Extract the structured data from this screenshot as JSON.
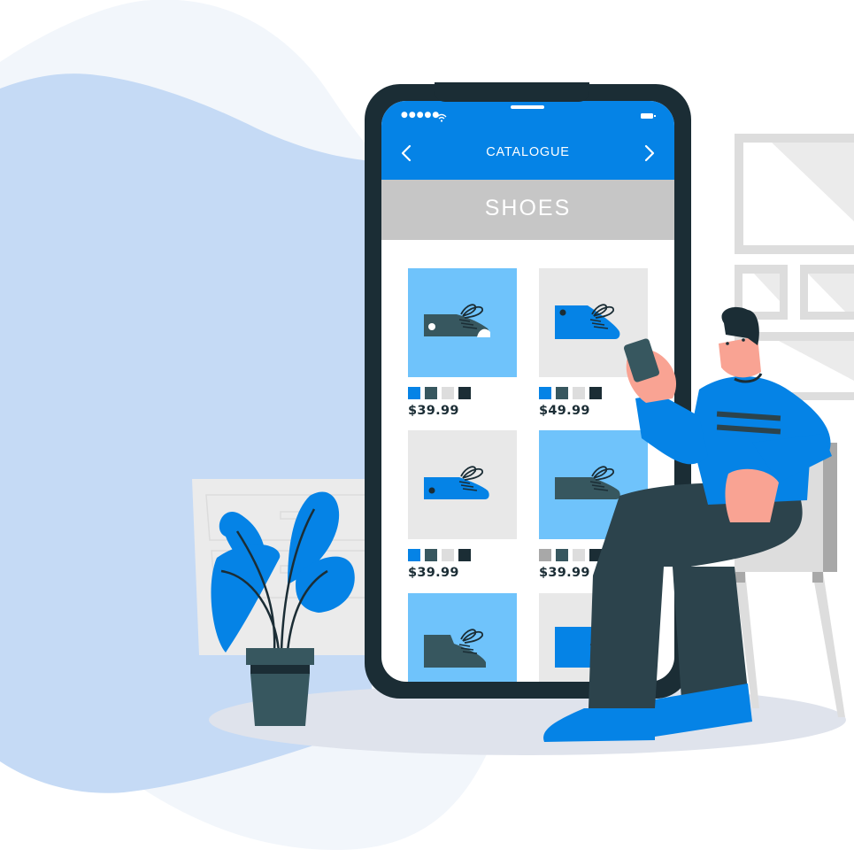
{
  "app": {
    "title": "CATALOGUE",
    "category": "SHOES",
    "status_bar": {
      "signal_icon": "signal-dots-icon",
      "wifi_icon": "wifi-icon",
      "battery_icon": "battery-icon"
    },
    "nav": {
      "back_icon": "chevron-left-icon",
      "forward_icon": "chevron-right-icon"
    }
  },
  "colors": {
    "brand_blue": "#0583e6",
    "light_blue": "#6fc3fb",
    "dark_navy": "#1b2d35",
    "slate": "#37575f",
    "light_gray": "#e8e8e8",
    "banner_gray": "#c6c6c6",
    "skin": "#f9a393",
    "backdrop_blue": "#c5daf5",
    "backdrop_pale": "#f2f6fb",
    "floor_shadow": "#dfe3ec"
  },
  "products": [
    {
      "price": "$39.99",
      "tile_color": "#6fc3fb",
      "shoe_color": "#37575f",
      "swatches": [
        "#0583e6",
        "#37575f",
        "#dddddd",
        "#1b2d35"
      ]
    },
    {
      "price": "$49.99",
      "tile_color": "#e8e8e8",
      "shoe_color": "#0583e6",
      "swatches": [
        "#0583e6",
        "#37575f",
        "#dddddd",
        "#1b2d35"
      ]
    },
    {
      "price": "$39.99",
      "tile_color": "#e8e8e8",
      "shoe_color": "#0583e6",
      "swatches": [
        "#0583e6",
        "#37575f",
        "#dddddd",
        "#1b2d35"
      ]
    },
    {
      "price": "$39.99",
      "tile_color": "#6fc3fb",
      "shoe_color": "#37575f",
      "swatches": [
        "#a8a8a8",
        "#37575f",
        "#dddddd",
        "#1b2d35"
      ]
    },
    {
      "price": "",
      "tile_color": "#6fc3fb",
      "shoe_color": "#37575f",
      "swatches": []
    },
    {
      "price": "",
      "tile_color": "#e8e8e8",
      "shoe_color": "#0583e6",
      "swatches": []
    }
  ]
}
